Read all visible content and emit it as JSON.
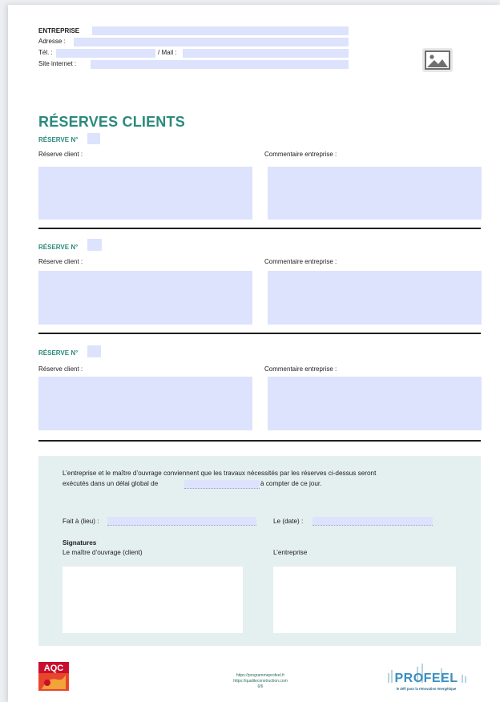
{
  "header": {
    "company_label": "ENTREPRISE",
    "address_label": "Adresse :",
    "phone_label": "Tél. :",
    "mail_label": "/ Mail :",
    "website_label": "Site internet :"
  },
  "title": "RÉSERVES CLIENTS",
  "reserves": [
    {
      "title": "RÉSERVE N°",
      "client_label": "Réserve client :",
      "comment_label": "Commentaire entreprise :"
    },
    {
      "title": "RÉSERVE N°",
      "client_label": "Réserve client :",
      "comment_label": "Commentaire entreprise :"
    },
    {
      "title": "RÉSERVE N°",
      "client_label": "Réserve client :",
      "comment_label": "Commentaire entreprise :"
    }
  ],
  "agreement": {
    "line1": "L’entreprise et le maître d’ouvrage conviennent que les travaux nécessités par les réserves ci-dessus seront",
    "line2_start": "exécutés dans un délai global de",
    "line2_end": "à compter de ce jour.",
    "place_label": "Fait à (lieu) :",
    "date_label": "Le (date) :",
    "signatures_title": "Signatures",
    "owner_label": "Le maître d’ouvrage (client)",
    "company_label": "L’entreprise"
  },
  "footer": {
    "aqc_logo": "AQC",
    "link1": "https://programmeprofeel.fr",
    "link2": "https://qualiteconstruction.com",
    "page": "6/6",
    "profeel_logo": "PROFEEL",
    "profeel_tagline": "le défi pour la rénovation énergétique"
  },
  "icons": {
    "image_placeholder": "image-icon"
  },
  "colors": {
    "accent": "#2a8a7c",
    "field": "#dde3fd",
    "panel": "#e4efef"
  }
}
